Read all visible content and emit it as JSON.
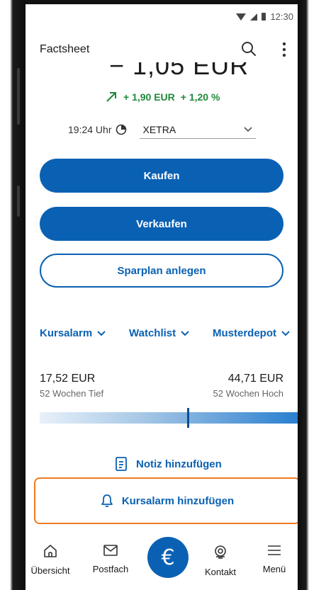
{
  "status_bar": {
    "time": "12:30"
  },
  "header": {
    "title": "Factsheet"
  },
  "quote": {
    "price_partial": "− 1,05 EUR",
    "change_abs": "+ 1,90 EUR",
    "change_pct": "+ 1,20 %",
    "time": "19:24 Uhr",
    "exchange": "XETRA"
  },
  "actions": {
    "buy": "Kaufen",
    "sell": "Verkaufen",
    "savings_plan": "Sparplan anlegen"
  },
  "dropdowns": {
    "alarm": "Kursalarm",
    "watchlist": "Watchlist",
    "model_depot": "Musterdepot"
  },
  "range_52w": {
    "low_value": "17,52 EUR",
    "low_label": "52 Wochen Tief",
    "high_value": "44,71 EUR",
    "high_label": "52 Wochen Hoch",
    "current_position": 0.575
  },
  "links": {
    "add_note": "Notiz hinzufügen",
    "add_alarm": "Kursalarm hinzufügen"
  },
  "bottom_nav": {
    "overview": "Übersicht",
    "inbox": "Postfach",
    "center_symbol": "€",
    "contact": "Kontakt",
    "menu": "Menü"
  },
  "colors": {
    "accent": "#0a61b3",
    "positive": "#1f8a3a",
    "highlight": "#f07a22"
  }
}
